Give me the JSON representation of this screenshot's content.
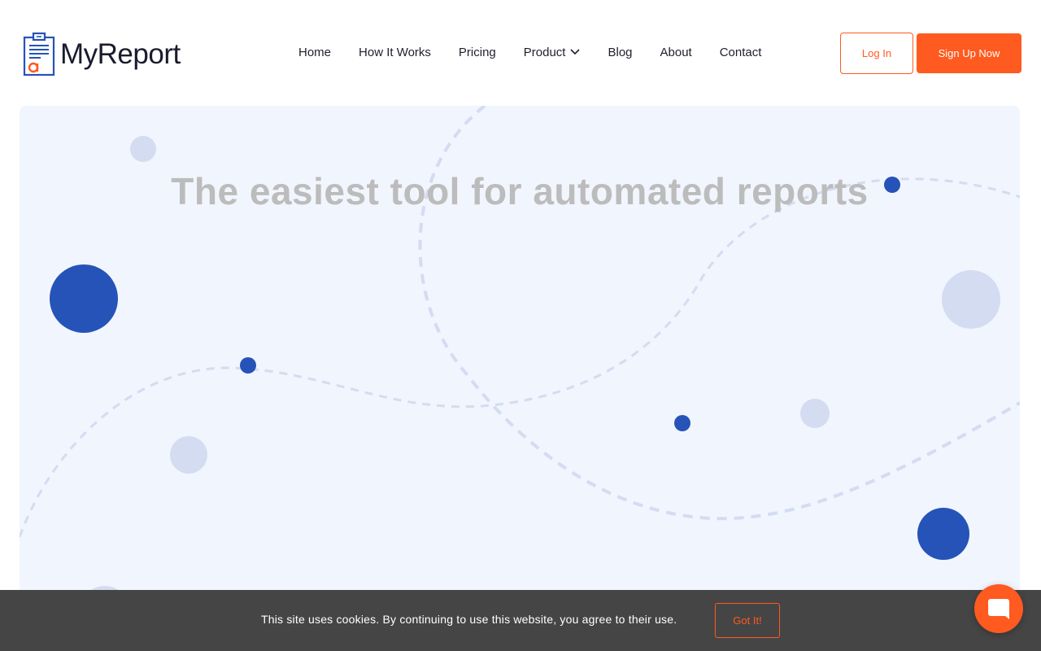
{
  "brand": {
    "name": "MyReport",
    "accent_color": "#ff5a1f",
    "logo_blue": "#2653b8"
  },
  "nav": {
    "items": [
      {
        "label": "Home"
      },
      {
        "label": "How It Works"
      },
      {
        "label": "Pricing"
      },
      {
        "label": "Product"
      },
      {
        "label": "Blog"
      },
      {
        "label": "About"
      },
      {
        "label": "Contact"
      }
    ],
    "login_label": "Log In",
    "signup_label": "Sign Up Now"
  },
  "hero": {
    "title": "The easiest tool for automated reports",
    "background_color": "#f1f5fd"
  },
  "cookie_bar": {
    "message": "This site uses cookies. By continuing to use this website, you agree to their use.",
    "button_label": "Got It!"
  },
  "icons": {
    "logo": "clipboard-report-icon",
    "product_dropdown": "chevron-down-icon",
    "chat": "chat-bubble-icon"
  }
}
